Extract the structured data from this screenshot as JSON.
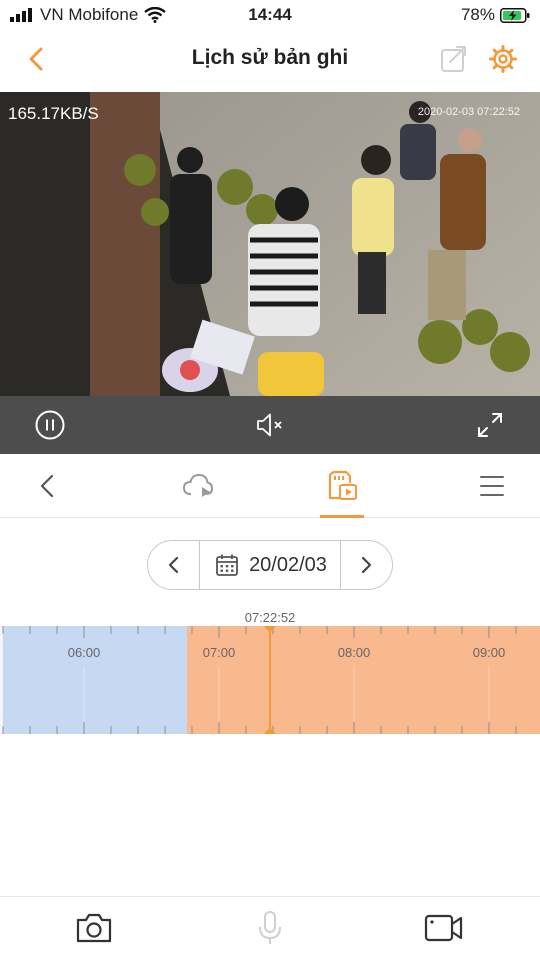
{
  "status_bar": {
    "carrier": "VN Mobifone",
    "time": "14:44",
    "battery": "78%"
  },
  "nav": {
    "title": "Lịch sử bản ghi"
  },
  "video": {
    "speed": "165.17KB/S",
    "timestamp": "2020-02-03 07:22:52"
  },
  "date_picker": {
    "date": "20/02/03"
  },
  "timeline": {
    "cursor_time": "07:22:52",
    "hour_labels": [
      "06:00",
      "07:00",
      "08:00",
      "09:00"
    ]
  },
  "colors": {
    "accent": "#f39a3c",
    "recorded_cloud": "#c6d9f3",
    "recorded_card": "#f8b98f"
  },
  "icons": {
    "back": "chevron-left-icon",
    "share": "share-icon",
    "settings": "gear-icon",
    "pause": "pause-icon",
    "mute": "speaker-muted-icon",
    "fullscreen": "fullscreen-icon",
    "cloud": "cloud-playback-icon",
    "sdcard": "sdcard-playback-icon",
    "menu": "menu-icon",
    "calendar": "calendar-icon",
    "snapshot": "camera-icon",
    "mic": "microphone-icon",
    "record": "video-record-icon"
  }
}
